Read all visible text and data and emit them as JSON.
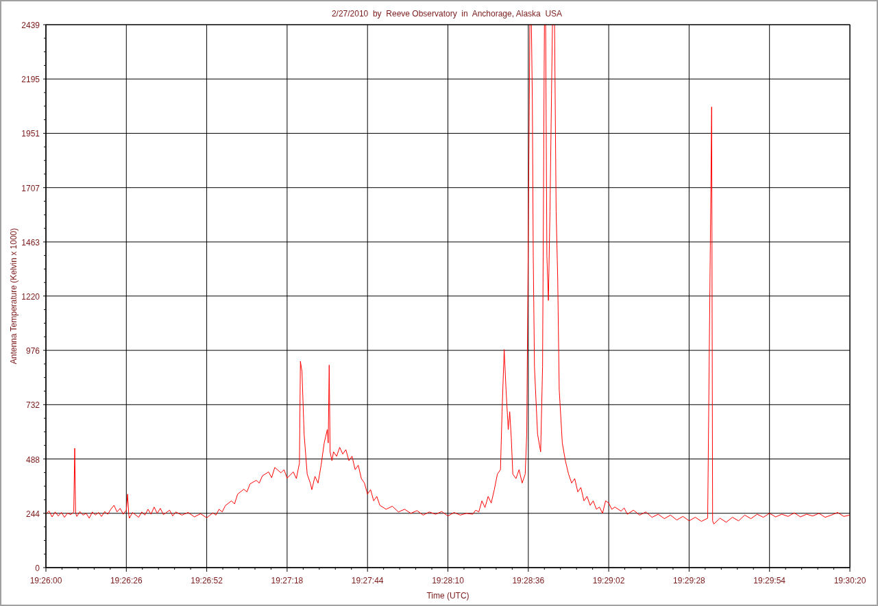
{
  "chart_data": {
    "type": "line",
    "title": "2/27/2010  by  Reeve Observatory  in  Anchorage, Alaska  USA",
    "xlabel": "Time (UTC)",
    "ylabel": "Antenna Temperature (Kelvin x 1000)",
    "grid": true,
    "xlim": [
      69960,
      70220
    ],
    "ylim": [
      0,
      2439
    ],
    "xticks": [
      {
        "value": 69960,
        "label": "19:26:00"
      },
      {
        "value": 69986,
        "label": "19:26:26"
      },
      {
        "value": 70012,
        "label": "19:26:52"
      },
      {
        "value": 70038,
        "label": "19:27:18"
      },
      {
        "value": 70064,
        "label": "19:27:44"
      },
      {
        "value": 70090,
        "label": "19:28:10"
      },
      {
        "value": 70116,
        "label": "19:28:36"
      },
      {
        "value": 70142,
        "label": "19:29:02"
      },
      {
        "value": 70168,
        "label": "19:29:28"
      },
      {
        "value": 70194,
        "label": "19:29:54"
      },
      {
        "value": 70220,
        "label": "19:30:20"
      }
    ],
    "yticks": [
      0,
      244,
      488,
      732,
      976,
      1220,
      1463,
      1707,
      1951,
      2195,
      2439
    ],
    "x": [
      69960,
      69961,
      69962,
      69963,
      69964,
      69965,
      69966,
      69967,
      69968,
      69969,
      69969.3,
      69969.6,
      69970,
      69971,
      69972,
      69973,
      69974,
      69975,
      69976,
      69977,
      69978,
      69979,
      69980,
      69981,
      69982,
      69983,
      69984,
      69985,
      69986,
      69986.4,
      69986.8,
      69987,
      69988,
      69990,
      69991,
      69992,
      69993,
      69994,
      69995,
      69996,
      69997,
      69998,
      70000,
      70001,
      70002,
      70004,
      70006,
      70008,
      70010,
      70012,
      70014,
      70015,
      70016,
      70017,
      70018,
      70020,
      70021,
      70022,
      70024,
      70025,
      70026,
      70028,
      70029,
      70030,
      70032,
      70033,
      70034,
      70036,
      70037,
      70038,
      70040,
      70041,
      70042,
      70042.3,
      70042.8,
      70043.5,
      70044.5,
      70045.5,
      70046,
      70047,
      70048,
      70049,
      70050,
      70051,
      70051.3,
      70051.6,
      70051.9,
      70052.5,
      70053,
      70054,
      70055,
      70056,
      70057,
      70058,
      70059,
      70060,
      70061,
      70062,
      70063,
      70064,
      70065,
      70066,
      70067,
      70068,
      70070,
      70072,
      70074,
      70076,
      70078,
      70080,
      70082,
      70084,
      70086,
      70088,
      70090,
      70092,
      70094,
      70096,
      70098,
      70099,
      70100,
      70101,
      70102,
      70103,
      70104,
      70105,
      70106,
      70107,
      70107.5,
      70108.2,
      70108.8,
      70109.5,
      70110,
      70110.5,
      70111,
      70112,
      70113,
      70114,
      70115,
      70115.5,
      70116,
      70116.5,
      70117,
      70117.3,
      70117.6,
      70118,
      70119,
      70120,
      70120.6,
      70121.2,
      70121.6,
      70122,
      70122.5,
      70123,
      70123.8,
      70124.5,
      70125,
      70125.5,
      70126,
      70127,
      70128,
      70129,
      70130,
      70131,
      70132,
      70133,
      70134,
      70135,
      70136,
      70137,
      70138,
      70139,
      70140,
      70141,
      70142,
      70143,
      70144,
      70146,
      70147,
      70148,
      70150,
      70152,
      70154,
      70156,
      70158,
      70160,
      70162,
      70164,
      70166,
      70168,
      70170,
      70172,
      70174,
      70175.3,
      70175.6,
      70176,
      70178,
      70180,
      70182,
      70184,
      70186,
      70188,
      70190,
      70192,
      70194,
      70196,
      70198,
      70200,
      70202,
      70204,
      70206,
      70208,
      70210,
      70212,
      70214,
      70216,
      70218,
      70220
    ],
    "series": [
      {
        "color": "#ff0000",
        "values": [
          240,
          255,
          228,
          250,
          232,
          248,
          226,
          245,
          238,
          250,
          536,
          245,
          230,
          252,
          236,
          244,
          222,
          250,
          236,
          248,
          230,
          252,
          240,
          262,
          280,
          250,
          266,
          240,
          258,
          330,
          236,
          222,
          248,
          226,
          250,
          236,
          262,
          240,
          272,
          244,
          266,
          238,
          258,
          232,
          250,
          236,
          248,
          228,
          242,
          224,
          246,
          236,
          262,
          250,
          278,
          300,
          286,
          330,
          352,
          340,
          376,
          392,
          380,
          412,
          430,
          404,
          450,
          426,
          440,
          402,
          430,
          400,
          470,
          927,
          880,
          600,
          420,
          380,
          350,
          410,
          380,
          460,
          560,
          620,
          560,
          910,
          520,
          480,
          520,
          500,
          540,
          510,
          530,
          480,
          500,
          440,
          460,
          400,
          380,
          330,
          350,
          300,
          320,
          280,
          262,
          276,
          250,
          262,
          244,
          256,
          236,
          250,
          240,
          252,
          232,
          248,
          236,
          244,
          240,
          258,
          250,
          300,
          270,
          320,
          290,
          350,
          420,
          440,
          700,
          980,
          800,
          620,
          700,
          580,
          420,
          400,
          440,
          380,
          420,
          600,
          1500,
          2439,
          2439,
          2100,
          1400,
          900,
          600,
          520,
          900,
          2439,
          2439,
          1400,
          1200,
          1600,
          2439,
          2439,
          1600,
          1300,
          800,
          560,
          480,
          420,
          380,
          400,
          340,
          360,
          300,
          320,
          280,
          300,
          262,
          272,
          244,
          300,
          290,
          262,
          272,
          254,
          268,
          240,
          258,
          236,
          250,
          226,
          240,
          220,
          236,
          214,
          230,
          210,
          226,
          208,
          222,
          2070,
          210,
          196,
          222,
          204,
          226,
          210,
          236,
          220,
          240,
          226,
          244,
          228,
          240,
          230,
          246,
          228,
          240,
          232,
          244,
          226,
          236,
          248,
          230,
          236
        ]
      }
    ]
  }
}
